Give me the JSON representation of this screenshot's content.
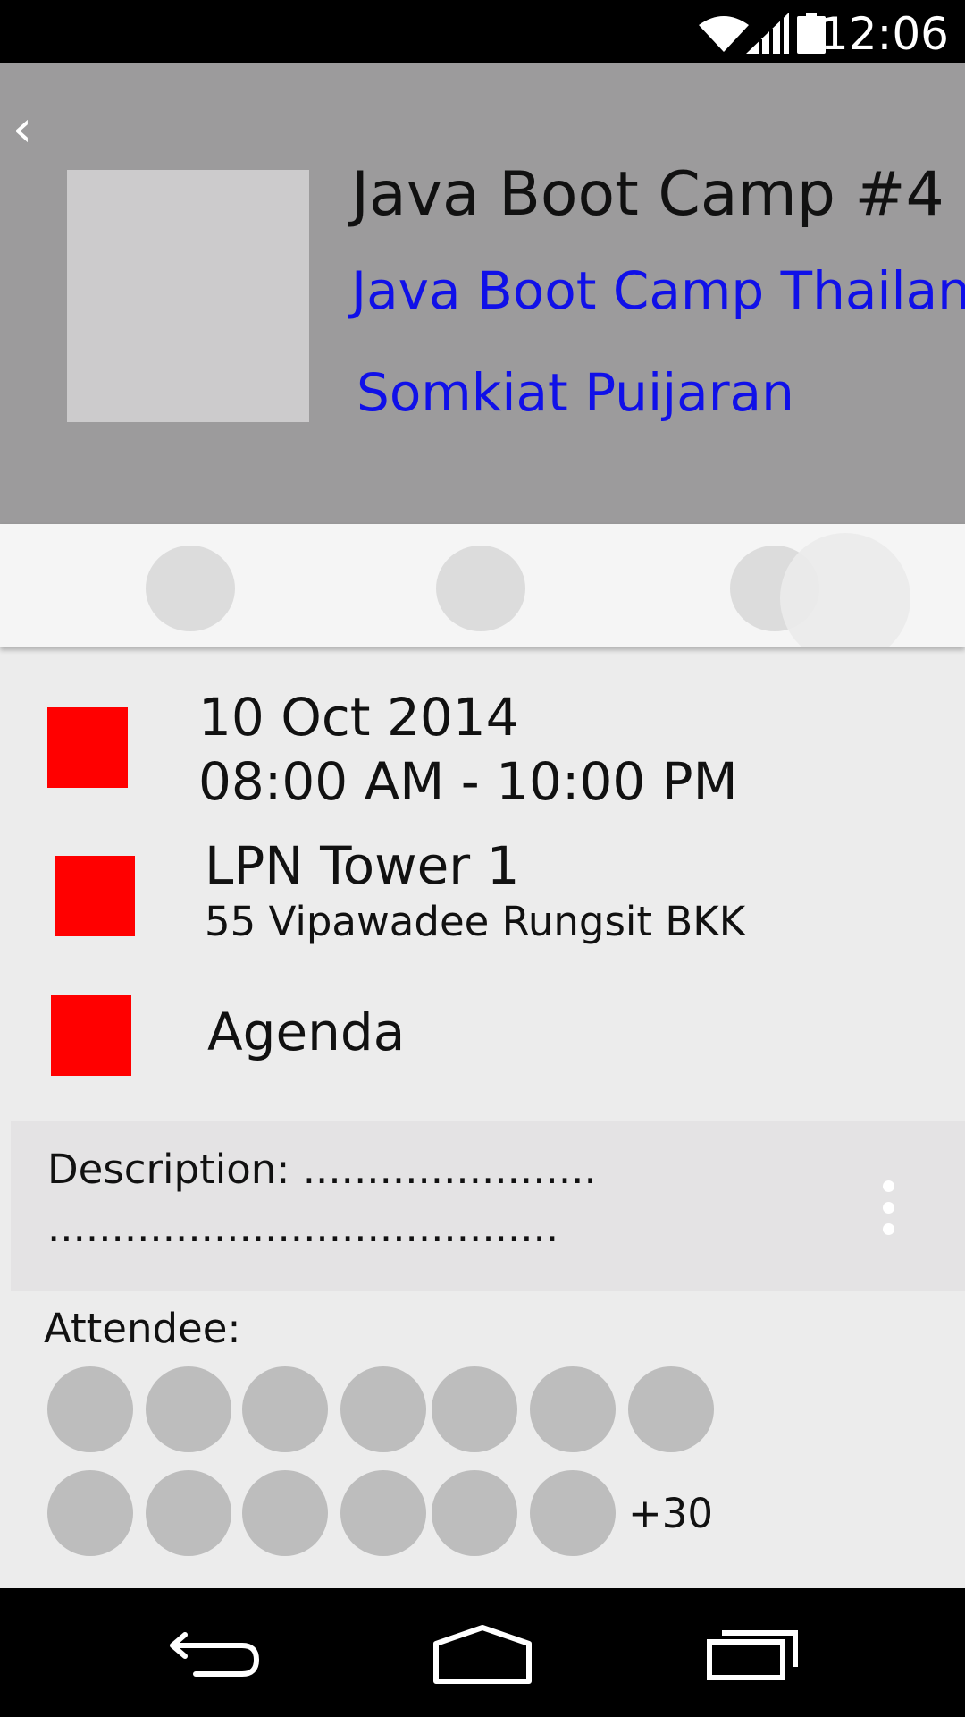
{
  "status_bar": {
    "time": "12:06",
    "icons": [
      "wifi-icon",
      "signal-icon",
      "battery-icon"
    ]
  },
  "header": {
    "back_icon": "‹",
    "title": "Java Boot Camp #4",
    "organizer": "Java Boot Camp Thailand",
    "host": "Somkiat Puijaran"
  },
  "event": {
    "date": "10 Oct 2014",
    "time": "08:00 AM - 10:00 PM",
    "place_name": "LPN Tower 1",
    "place_address": "55 Vipawadee Rungsit BKK",
    "agenda": "Agenda"
  },
  "description": {
    "line1": "Description: .......................",
    "line2": "........................................"
  },
  "attendees": {
    "label": "Attendee:",
    "more_count": "+30"
  },
  "colors": {
    "header_bg": "#9c9b9c",
    "link": "#1010e8",
    "marker": "#ff0000",
    "background": "#ececec"
  },
  "nav_bar": {
    "icons": [
      "back-nav-icon",
      "home-nav-icon",
      "recents-nav-icon"
    ]
  }
}
